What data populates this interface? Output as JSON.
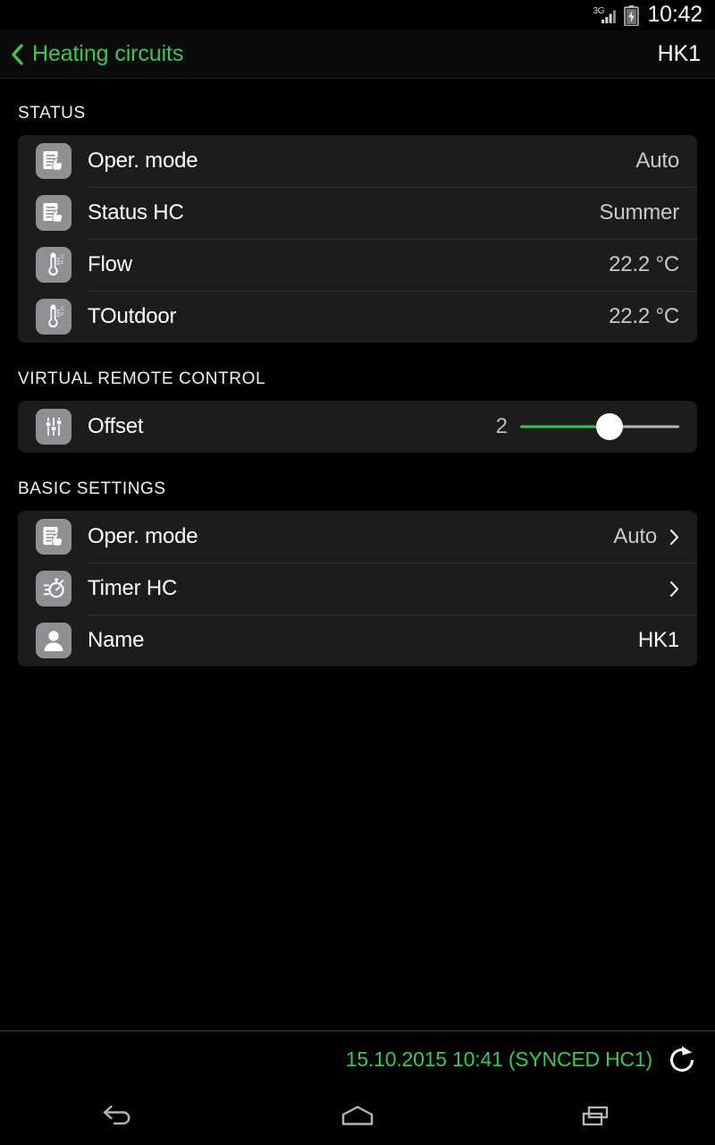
{
  "statusbar": {
    "network_label": "3G",
    "signal_icon": "signal-bars-icon",
    "battery_icon": "battery-charging-icon",
    "time": "10:42"
  },
  "actionbar": {
    "back_icon": "chevron-left-icon",
    "back_title": "Heating circuits",
    "right_title": "HK1"
  },
  "colors": {
    "accent_green": "#3dc654",
    "slider_green": "#35c353",
    "card_bg": "#1c1c1c",
    "page_bg": "#000000",
    "icon_tile": "#8e9094"
  },
  "sections": [
    {
      "title": "STATUS",
      "rows": [
        {
          "icon": "document-hand-icon",
          "label": "Oper. mode",
          "value": "Auto",
          "chevron": false
        },
        {
          "icon": "document-hand-icon",
          "label": "Status HC",
          "value": "Summer",
          "chevron": false
        },
        {
          "icon": "thermometer-icon",
          "label": "Flow",
          "value": "22.2 °C",
          "chevron": false
        },
        {
          "icon": "thermometer-icon",
          "label": "TOutdoor",
          "value": "22.2 °C",
          "chevron": false
        }
      ]
    },
    {
      "title": "VIRTUAL REMOTE CONTROL",
      "rows": [
        {
          "icon": "faders-icon",
          "label": "Offset",
          "slider": {
            "value": "2",
            "percent": 56
          }
        }
      ]
    },
    {
      "title": "BASIC SETTINGS",
      "rows": [
        {
          "icon": "document-hand-icon",
          "label": "Oper. mode",
          "value": "Auto",
          "chevron": true
        },
        {
          "icon": "stopwatch-icon",
          "label": "Timer HC",
          "value": "",
          "chevron": true
        },
        {
          "icon": "person-icon",
          "label": "Name",
          "value": "HK1",
          "chevron": false
        }
      ]
    }
  ],
  "footer": {
    "sync_text": "15.10.2015 10:41 (SYNCED HC1)",
    "refresh_icon": "refresh-icon"
  },
  "navbar": {
    "back_icon": "nav-back-icon",
    "home_icon": "nav-home-icon",
    "recents_icon": "nav-recents-icon"
  }
}
